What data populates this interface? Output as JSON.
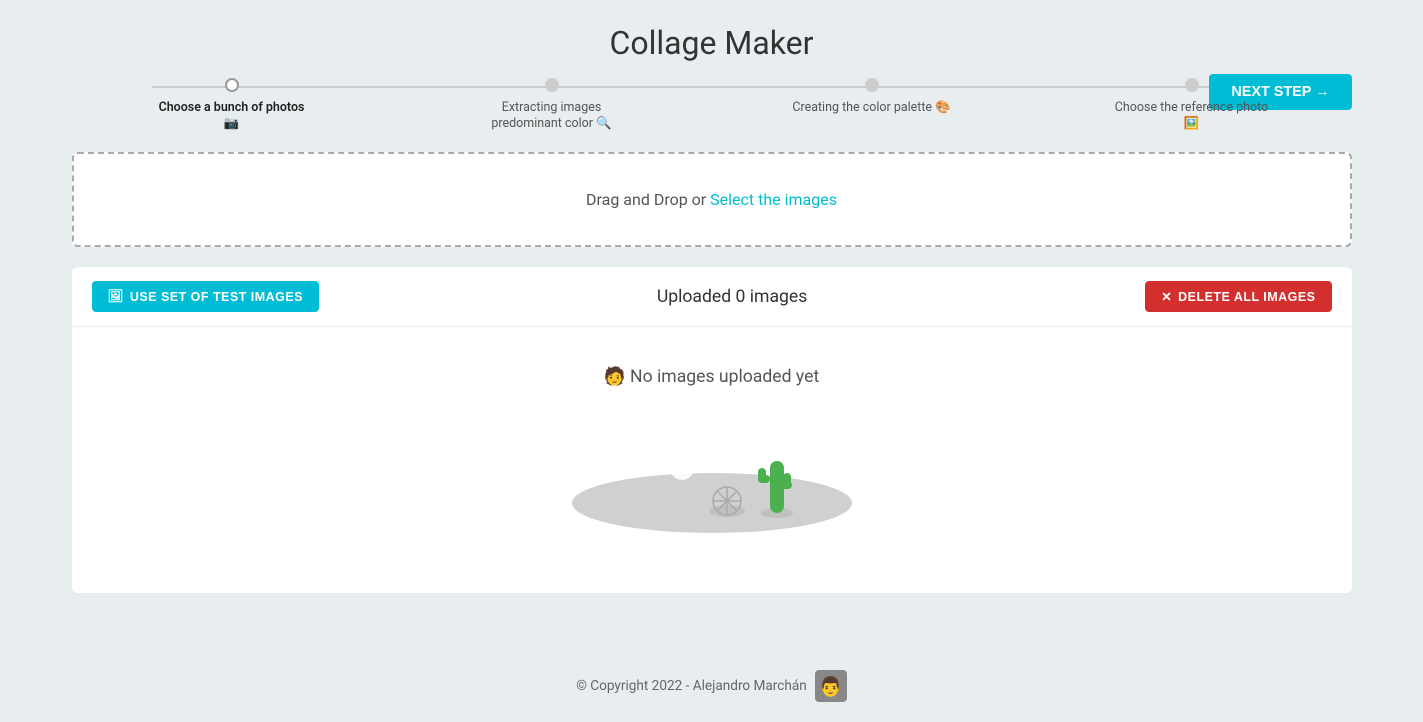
{
  "app": {
    "title": "Collage Maker"
  },
  "stepper": {
    "steps": [
      {
        "id": "step1",
        "label": "Choose a bunch of photos 📷",
        "active": true
      },
      {
        "id": "step2",
        "label": "Extracting images predominant color 🔍",
        "active": false
      },
      {
        "id": "step3",
        "label": "Creating the color palette 🎨",
        "active": false
      },
      {
        "id": "step4",
        "label": "Choose the reference photo 🖼️",
        "active": false
      }
    ],
    "next_button_label": "NEXT STEP →"
  },
  "dropzone": {
    "text": "Drag and Drop or ",
    "link_text": "Select the images"
  },
  "upload_panel": {
    "test_button_label": "USE SET OF TEST IMAGES",
    "title": "Uploaded 0 images",
    "delete_button_label": "DELETE ALL IMAGES",
    "empty_text": "🧑 No images uploaded yet"
  },
  "footer": {
    "copyright": "© Copyright 2022 - Alejandro Marchán"
  },
  "colors": {
    "teal": "#00bcd4",
    "red": "#d32f2f",
    "bg": "#e8eef0"
  }
}
